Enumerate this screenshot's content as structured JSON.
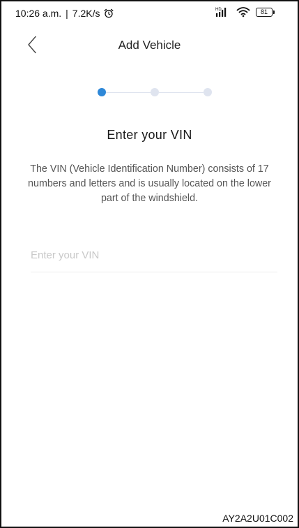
{
  "status_bar": {
    "time": "10:26 a.m.",
    "separator": "|",
    "net_speed": "7.2K/s",
    "battery_level": "81",
    "signal_label": "HD"
  },
  "header": {
    "title": "Add Vehicle"
  },
  "stepper": {
    "steps": 3,
    "current_step": 1,
    "active_color": "#2e88d8",
    "inactive_color": "#dfe4ef"
  },
  "main": {
    "heading": "Enter your VIN",
    "description": "The VIN (Vehicle Identification Number) consists of 17 numbers and letters and is usually located on the lower part of the windshield.",
    "vin_input": {
      "value": "",
      "placeholder": "Enter your VIN"
    }
  },
  "watermark": "AY2A2U01C002",
  "icons": {
    "back": "chevron-left-icon",
    "alarm": "alarm-clock-icon",
    "signal": "signal-icon",
    "wifi": "wifi-icon",
    "battery": "battery-icon"
  }
}
